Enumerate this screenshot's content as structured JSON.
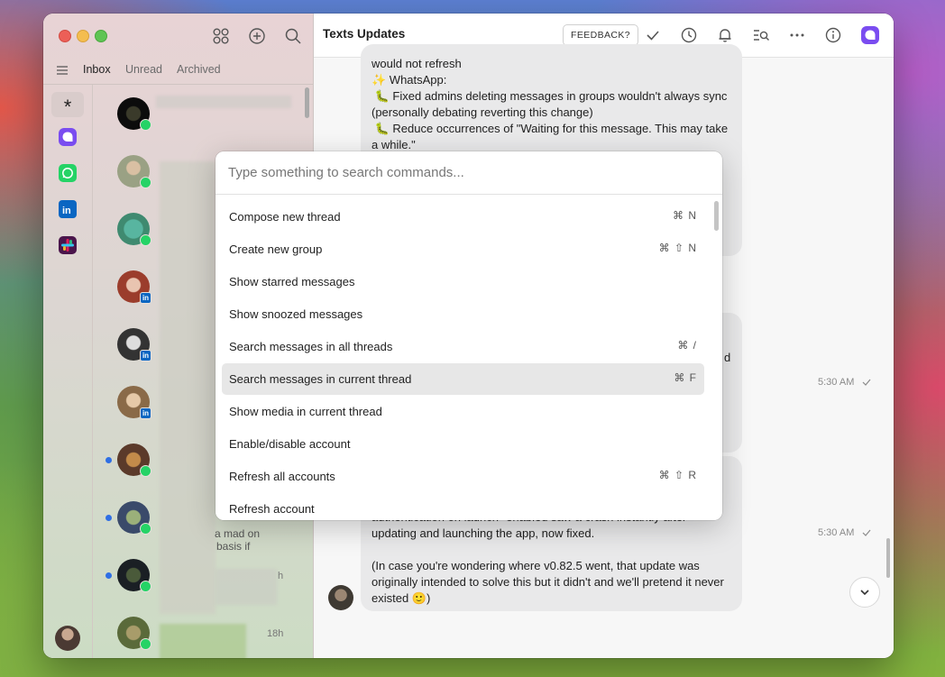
{
  "window": {
    "left_tabs": [
      {
        "label": "Inbox",
        "active": true
      },
      {
        "label": "Unread",
        "active": false
      },
      {
        "label": "Archived",
        "active": false
      }
    ],
    "accounts_rail": [
      "all-accounts",
      "texts",
      "whatsapp",
      "linkedin",
      "slack"
    ],
    "thread_snippets": {
      "snippet_a": "a mad on",
      "snippet_b": "basis if",
      "time_a": "h",
      "time_b": "18h"
    }
  },
  "thread": {
    "title": "Texts Updates",
    "feedback_label": "FEEDBACK?",
    "message1": "would not refresh\n✨ WhatsApp:\n 🐛 Fixed admins deleting messages in groups wouldn't always sync (personally debating reverting this change)\n 🐛 Reduce occurrences of \"Waiting for this message. This may take a while.\"",
    "message2_fragment": "d",
    "message3": "authentication on launch\" enabled saw a crash instantly after updating and launching the app, now fixed.\n\n(In case you're wondering where v0.82.5 went, that update was originally intended to solve this but it didn't and we'll pretend it never existed 🙂)",
    "time1": "5:30 AM",
    "time2": "5:30 AM"
  },
  "palette": {
    "placeholder": "Type something to search commands...",
    "commands": [
      {
        "label": "Compose new thread",
        "shortcut": "⌘ N"
      },
      {
        "label": "Create new group",
        "shortcut": "⌘ ⇧ N"
      },
      {
        "label": "Show starred messages",
        "shortcut": ""
      },
      {
        "label": "Show snoozed messages",
        "shortcut": ""
      },
      {
        "label": "Search messages in all threads",
        "shortcut": "⌘ /"
      },
      {
        "label": "Search messages in current thread",
        "shortcut": "⌘ F",
        "selected": true
      },
      {
        "label": "Show media in current thread",
        "shortcut": ""
      },
      {
        "label": "Enable/disable account",
        "shortcut": ""
      },
      {
        "label": "Refresh all accounts",
        "shortcut": "⌘ ⇧ R"
      },
      {
        "label": "Refresh account",
        "shortcut": ""
      }
    ]
  },
  "colors": {
    "accent": "#7a4cf0",
    "whatsapp": "#25d366",
    "linkedin": "#0a66c2",
    "unread_dot": "#2f6fe4"
  }
}
